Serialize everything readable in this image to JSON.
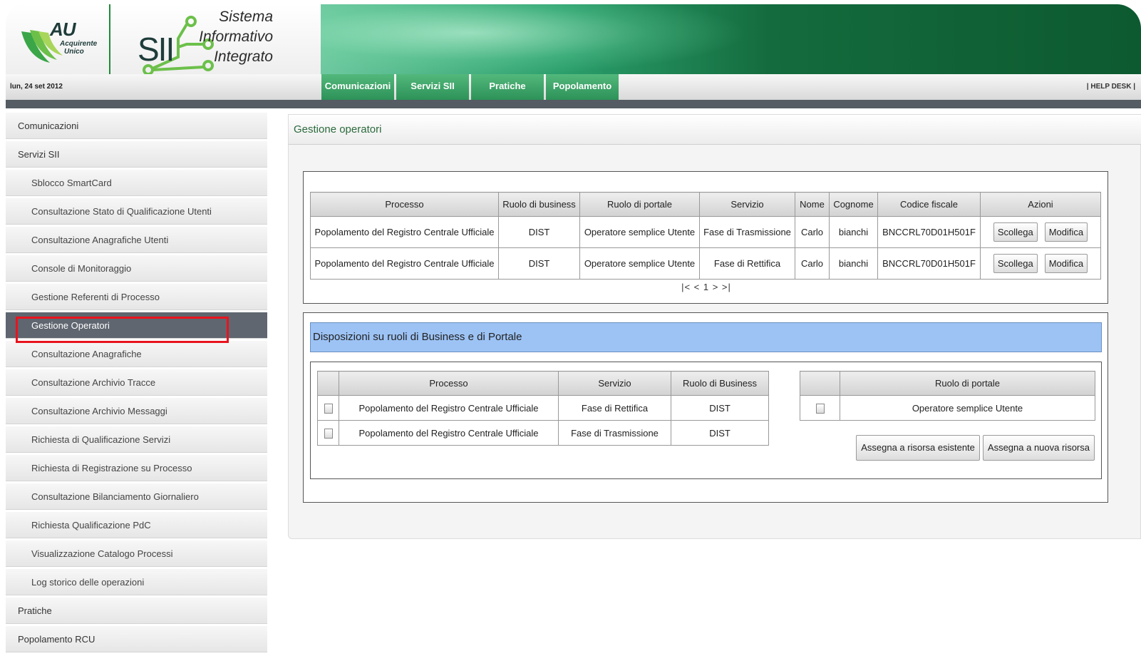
{
  "header": {
    "au_logo": "AU",
    "au_logo_sub1": "Acquirente",
    "au_logo_sub2": "Unico",
    "sii_logo": "SII",
    "sii_title": [
      "Sistema",
      "Informativo",
      "Integrato"
    ]
  },
  "navbar": {
    "date": "lun, 24 set 2012",
    "tabs": [
      "Comunicazioni",
      "Servizi SII",
      "Pratiche",
      "Popolamento RCU"
    ],
    "helpdesk": "| HELP DESK |"
  },
  "sidebar": {
    "items": [
      {
        "label": "Comunicazioni",
        "level": 0
      },
      {
        "label": "Servizi SII",
        "level": 0
      },
      {
        "label": "Sblocco SmartCard",
        "level": 1
      },
      {
        "label": "Consultazione Stato di Qualificazione Utenti",
        "level": 1
      },
      {
        "label": "Consultazione Anagrafiche Utenti",
        "level": 1
      },
      {
        "label": "Console di Monitoraggio",
        "level": 1
      },
      {
        "label": "Gestione Referenti di Processo",
        "level": 1
      },
      {
        "label": "Gestione Operatori",
        "level": 1,
        "active": true
      },
      {
        "label": "Consultazione Anagrafiche",
        "level": 1
      },
      {
        "label": "Consultazione Archivio Tracce",
        "level": 1
      },
      {
        "label": "Consultazione Archivio Messaggi",
        "level": 1
      },
      {
        "label": "Richiesta di Qualificazione Servizi",
        "level": 1
      },
      {
        "label": "Richiesta di Registrazione su Processo",
        "level": 1
      },
      {
        "label": "Consultazione Bilanciamento Giornaliero",
        "level": 1
      },
      {
        "label": "Richiesta Qualificazione PdC",
        "level": 1
      },
      {
        "label": "Visualizzazione Catalogo Processi",
        "level": 1
      },
      {
        "label": "Log storico delle operazioni",
        "level": 1
      },
      {
        "label": "Pratiche",
        "level": 0
      },
      {
        "label": "Popolamento RCU",
        "level": 0
      }
    ]
  },
  "main": {
    "title": "Gestione operatori",
    "operators_table": {
      "columns": [
        "Processo",
        "Ruolo di business",
        "Ruolo di portale",
        "Servizio",
        "Nome",
        "Cognome",
        "Codice fiscale",
        "Azioni"
      ],
      "rows": [
        [
          "Popolamento del Registro Centrale Ufficiale",
          "DIST",
          "Operatore semplice Utente",
          "Fase di Trasmissione",
          "Carlo",
          "bianchi",
          "BNCCRL70D01H501F"
        ],
        [
          "Popolamento del Registro Centrale Ufficiale",
          "DIST",
          "Operatore semplice Utente",
          "Fase di Rettifica",
          "Carlo",
          "bianchi",
          "BNCCRL70D01H501F"
        ]
      ],
      "action_scollega": "Scollega",
      "action_modifica": "Modifica",
      "pager": "|< < 1 > >|"
    },
    "disposizioni": {
      "title": "Disposizioni su ruoli di Business e di Portale",
      "business_table": {
        "columns": [
          "",
          "Processo",
          "Servizio",
          "Ruolo di Business"
        ],
        "rows": [
          [
            "Popolamento del Registro Centrale Ufficiale",
            "Fase di Rettifica",
            "DIST"
          ],
          [
            "Popolamento del Registro Centrale Ufficiale",
            "Fase di Trasmissione",
            "DIST"
          ]
        ]
      },
      "portal_table": {
        "columns": [
          "",
          "Ruolo di portale"
        ],
        "rows": [
          [
            "Operatore semplice Utente"
          ]
        ]
      },
      "assign_existing": "Assegna a risorsa esistente",
      "assign_new": "Assegna a nuova risorsa"
    }
  },
  "colors": {
    "nav_green": "#3fa86a",
    "active_sidebar": "#5f6670",
    "highlight": "#e8141e",
    "disposizioni_bar": "#9dc3f5",
    "title_green": "#2b6a3c"
  }
}
